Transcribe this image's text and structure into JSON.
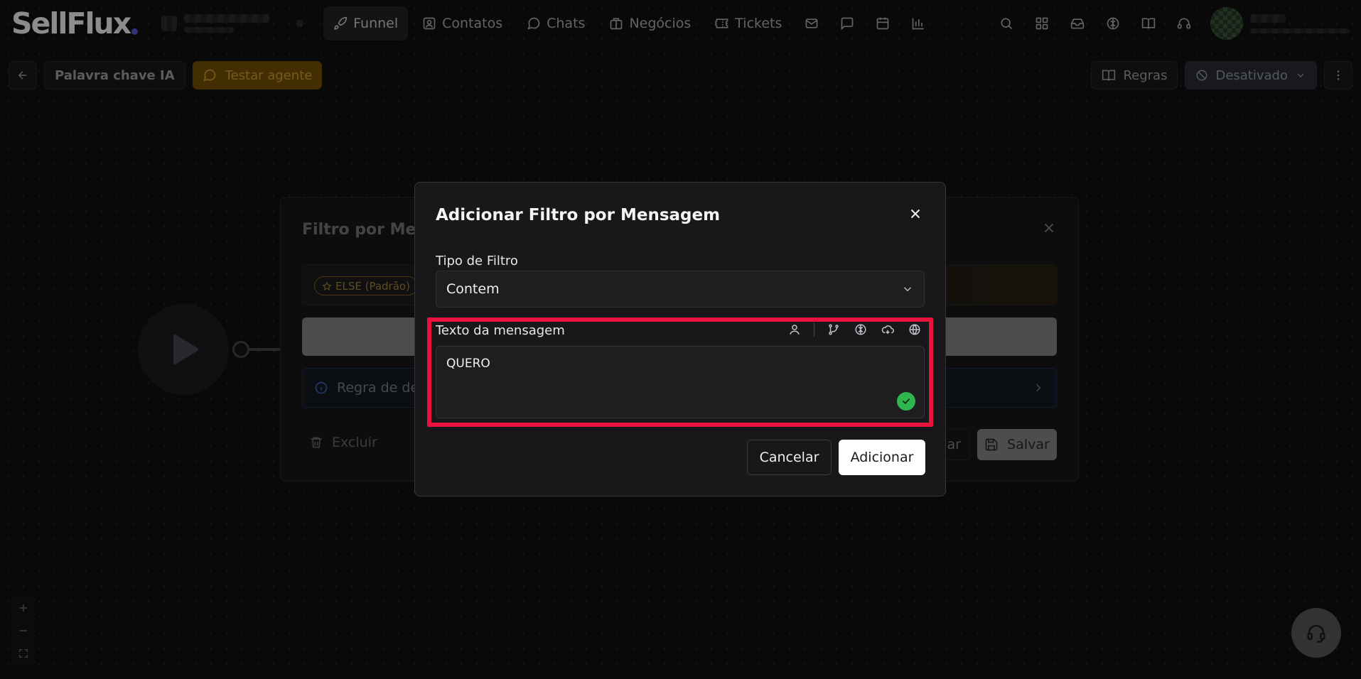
{
  "brand": {
    "logo_text": "SellFlux"
  },
  "nav": {
    "items": [
      {
        "label": "Funnel",
        "icon": "rocket-icon",
        "active": true
      },
      {
        "label": "Contatos",
        "icon": "contact-card-icon",
        "active": false
      },
      {
        "label": "Chats",
        "icon": "chat-bubble-icon",
        "active": false
      },
      {
        "label": "Negócios",
        "icon": "briefcase-icon",
        "active": false
      },
      {
        "label": "Tickets",
        "icon": "ticket-icon",
        "active": false
      }
    ],
    "icon_only": [
      "mail-icon",
      "message-square-icon",
      "calendar-icon",
      "bar-chart-icon"
    ]
  },
  "header_icons": [
    "search-icon",
    "apps-grid-icon",
    "inbox-icon",
    "brain-icon",
    "book-open-icon",
    "headset-icon"
  ],
  "subbar": {
    "title": "Palavra chave IA",
    "test_agent_label": "Testar agente",
    "rules_label": "Regras",
    "status_label": "Desativado"
  },
  "panel": {
    "title": "Filtro por Men",
    "else_tag": "ELSE (Padrão)",
    "info_text": "Regra de dec",
    "delete_label": "Excluir",
    "cut_button_label": "ar",
    "save_label": "Salvar"
  },
  "modal": {
    "title": "Adicionar Filtro por Mensagem",
    "filter_type_label": "Tipo de Filtro",
    "filter_type_value": "Contem",
    "message_text_label": "Texto da mensagem",
    "message_text_value": "QUERO",
    "toolbar_icons": [
      "user-icon",
      "git-branch-icon",
      "brain-icon",
      "cloud-sync-icon",
      "globe-icon"
    ],
    "cancel_label": "Cancelar",
    "add_label": "Adicionar"
  },
  "colors": {
    "highlight": "#e8133d",
    "accent_orange": "#7a5408",
    "success_green": "#2fb64e",
    "brand_dot": "#5b5ce2"
  }
}
